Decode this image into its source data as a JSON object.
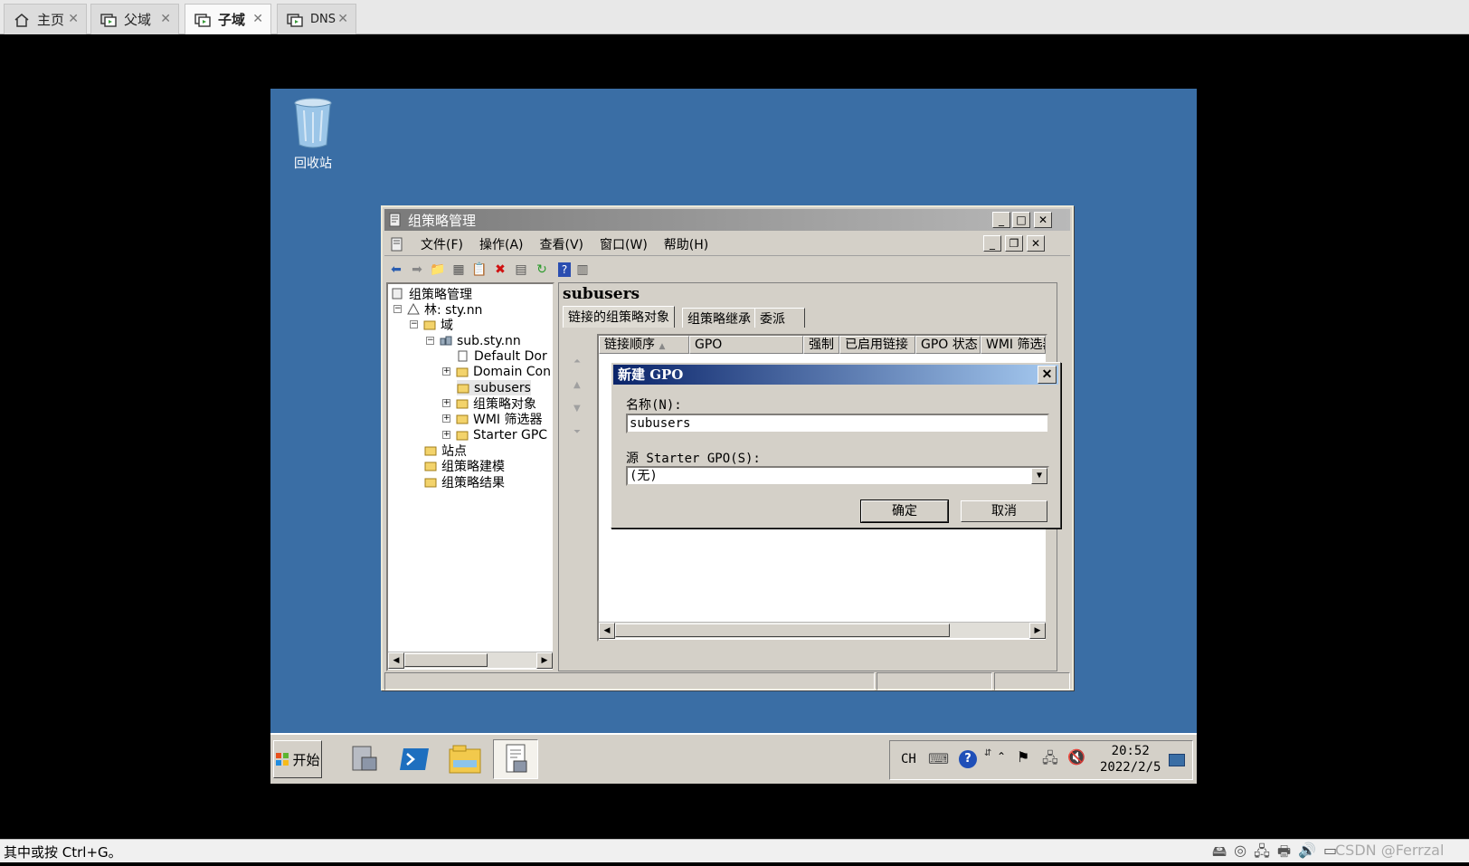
{
  "host": {
    "tabs": [
      {
        "label": "主页",
        "icon": "home-icon"
      },
      {
        "label": "父域",
        "icon": "vm-icon"
      },
      {
        "label": "子域",
        "icon": "vm-icon"
      },
      {
        "label": "DNS",
        "icon": "vm-icon"
      }
    ],
    "status_text": "其中或按 Ctrl+G。",
    "watermark": "CSDN @Ferrzal"
  },
  "desktop": {
    "recycle_bin_label": "回收站"
  },
  "mmc": {
    "title": "组策略管理",
    "menu": [
      "文件(F)",
      "操作(A)",
      "查看(V)",
      "窗口(W)",
      "帮助(H)"
    ],
    "tree": {
      "root": "组策略管理",
      "forest": "林: sty.nn",
      "domains": "域",
      "domain": "sub.sty.nn",
      "default_policy": "Default Dor",
      "domain_controllers": "Domain Con",
      "subusers": "subusers",
      "gpo_objects": "组策略对象",
      "wmi_filters": "WMI 筛选器",
      "starter_gpo": "Starter GPC",
      "sites": "站点",
      "modeling": "组策略建模",
      "results": "组策略结果"
    },
    "pane_title": "subusers",
    "tabs": [
      "链接的组策略对象",
      "组策略继承",
      "委派"
    ],
    "columns": [
      "链接顺序",
      "GPO",
      "强制",
      "已启用链接",
      "GPO 状态",
      "WMI 筛选器"
    ]
  },
  "dialog": {
    "title": "新建 GPO",
    "name_label": "名称(N):",
    "name_value": "subusers",
    "source_label": "源 Starter GPO(S):",
    "source_value": "(无)",
    "ok_label": "确定",
    "cancel_label": "取消"
  },
  "taskbar": {
    "start_label": "开始",
    "lang": "CH",
    "time": "20:52",
    "date": "2022/2/5"
  }
}
